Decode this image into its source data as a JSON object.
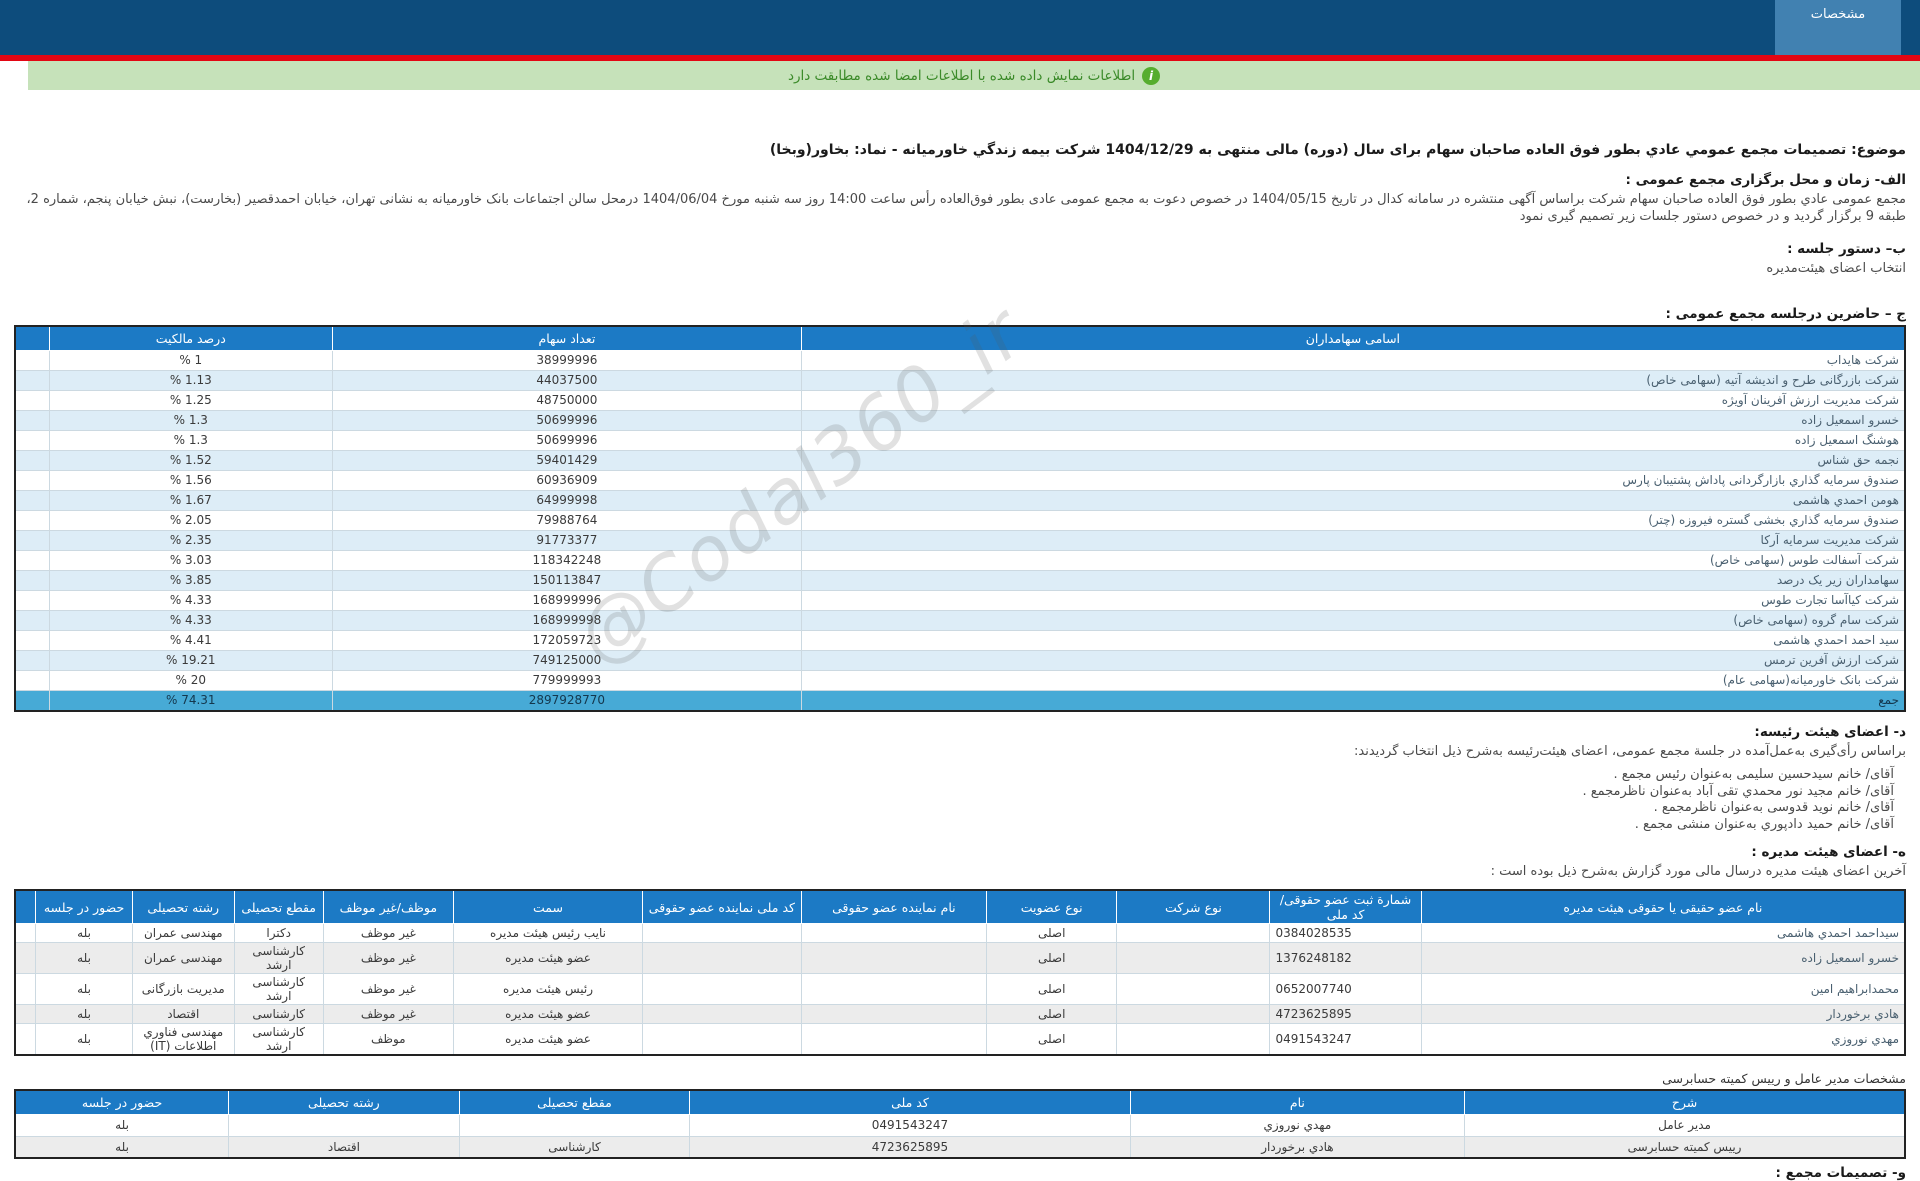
{
  "header": {
    "tab_label": "مشخصات"
  },
  "notice": {
    "text": "اطلاعات نمایش داده شده با اطلاعات امضا شده مطابقت دارد",
    "icon": "info-icon"
  },
  "watermark": "@Codal360_ir",
  "subject": "موضوع: تصمیمات مجمع عمومي عادي بطور فوق العاده صاحبان سهام برای سال (دوره) مالی منتهی به 1404/12/29 شرکت بیمه زندگي خاورمیانه - نماد: بخاور(وبخا)",
  "section_a": {
    "title": "الف- زمان و محل برگزاری مجمع عمومی :",
    "body": "مجمع عمومی عادي بطور فوق العاده صاحبان سهام شرکت براساس آگهی منتشره در سامانه کدال در تاریخ 1404/05/15 در خصوص دعوت به مجمع عمومی عادی بطور فوق‌العاده رأس ساعت 14:00 روز سه شنبه مورخ 1404/06/04 درمحل سالن اجتماعات بانک خاورمیانه به نشانی تهران، خیابان احمدقصیر (بخارست)، نبش خیابان پنجم، شماره 2، طبقه 9 برگزار گردید و در خصوص دستور جلسات زیر تصمیم گیری نمود"
  },
  "section_b": {
    "title": "ب– دستور جلسه :",
    "body": "انتخاب اعضای هیئت‌مدیره"
  },
  "section_c": {
    "title": "ج – حاضرین درجلسه مجمع عمومی :",
    "table": {
      "columns": [
        "اسامی سهامداران",
        "تعداد سهام",
        "درصد مالکیت"
      ],
      "rows": [
        [
          "شرکت هایداب",
          "38999996",
          "% 1"
        ],
        [
          "شرکت بازرگانی طرح و اندیشه آتیه (سهامی خاص)",
          "44037500",
          "% 1.13"
        ],
        [
          "شرکت مدیریت ارزش آفرینان آویژه",
          "48750000",
          "% 1.25"
        ],
        [
          "خسرو اسمعیل زاده",
          "50699996",
          "% 1.3"
        ],
        [
          "هوشنگ اسمعیل زاده",
          "50699996",
          "% 1.3"
        ],
        [
          "نجمه حق شناس",
          "59401429",
          "% 1.52"
        ],
        [
          "صندوق سرمایه گذاري بازارگردانی پاداش پشتیبان پارس",
          "60936909",
          "% 1.56"
        ],
        [
          "هومن احمدي هاشمی",
          "64999998",
          "% 1.67"
        ],
        [
          "صندوق سرمایه گذاري بخشی گستره فیروزه (چتر)",
          "79988764",
          "% 2.05"
        ],
        [
          "شرکت مدیریت سرمایه آرکا",
          "91773377",
          "% 2.35"
        ],
        [
          "شرکت آسفالت طوس (سهامی خاص)",
          "118342248",
          "% 3.03"
        ],
        [
          "سهامداران زیر یک درصد",
          "150113847",
          "% 3.85"
        ],
        [
          "شرکت کیاآسا تجارت طوس",
          "168999996",
          "% 4.33"
        ],
        [
          "شرکت سام گروه (سهامی خاص)",
          "168999998",
          "% 4.33"
        ],
        [
          "سید احمد احمدي هاشمی",
          "172059723",
          "% 4.41"
        ],
        [
          "شرکت ارزش آفرین ترمس",
          "749125000",
          "% 19.21"
        ],
        [
          "شرکت بانک خاورمیانه(سهامی عام)",
          "779999993",
          "% 20"
        ]
      ],
      "total": [
        "جمع",
        "2897928770",
        "% 74.31"
      ]
    }
  },
  "section_d": {
    "title": "د- اعضای هیئت رئیسه:",
    "body": "براساس رأی‌گیری به‌عمل‌آمده در جلسة مجمع عمومی، اعضای هیئت‌رئیسه به‌شرح ذیل انتخاب گردیدند:",
    "members": [
      "آقای/ خانم  سیدحسین سلیمی  به‌عنوان رئیس مجمع .",
      "آقای/ خانم  مجید نور محمدي تقی آباد  به‌عنوان ناظرمجمع .",
      "آقای/ خانم  نوید قدوسی  به‌عنوان ناظرمجمع .",
      "آقای/ خانم  حمید دادپوري  به‌عنوان منشی مجمع ."
    ]
  },
  "section_e": {
    "title": "ه- اعضای هیئت مدیره :",
    "body": "آخرین اعضای هیئت مدیره درسال مالی مورد گزارش به‌شرح ذیل بوده است :",
    "table": {
      "columns": [
        "نام عضو حقیقی یا حقوقی هیئت مدیره",
        "شمارة ثبت عضو حقوقی/کد ملی",
        "نوع شرکت",
        "نوع عضویت",
        "نام نماینده عضو حقوقی",
        "کد ملی نماینده عضو حقوقی",
        "سمت",
        "موظف/غیر موظف",
        "مقطع تحصیلی",
        "رشته تحصیلی",
        "حضور در جلسه"
      ],
      "rows": [
        [
          "سیداحمد احمدي هاشمی",
          "0384028535",
          "",
          "اصلی",
          "",
          "",
          "نایب رئیس هیئت مدیره",
          "غیر موظف",
          "دکترا",
          "مهندسی عمران",
          "بله"
        ],
        [
          "خسرو اسمعیل زاده",
          "1376248182",
          "",
          "اصلی",
          "",
          "",
          "عضو هیئت مدیره",
          "غیر موظف",
          "کارشناسی ارشد",
          "مهندسی عمران",
          "بله"
        ],
        [
          "محمدابراهیم امین",
          "0652007740",
          "",
          "اصلی",
          "",
          "",
          "رئیس هیئت مدیره",
          "غیر موظف",
          "کارشناسی ارشد",
          "مدیریت بازرگانی",
          "بله"
        ],
        [
          "هادي برخوردار",
          "4723625895",
          "",
          "اصلی",
          "",
          "",
          "عضو هیئت مدیره",
          "غیر موظف",
          "کارشناسی",
          "اقتصاد",
          "بله"
        ],
        [
          "مهدي نوروزي",
          "0491543247",
          "",
          "اصلی",
          "",
          "",
          "عضو هیئت مدیره",
          "موظف",
          "کارشناسی ارشد",
          "مهندسی فناوري اطلاعات (IT)",
          "بله"
        ]
      ]
    }
  },
  "ceo_section": {
    "title": "مشخصات مدیر عامل و رییس کمیته حسابرسی",
    "table": {
      "columns": [
        "شرح",
        "نام",
        "کد ملی",
        "مقطع تحصیلی",
        "رشته تحصیلی",
        "حضور در جلسه"
      ],
      "rows": [
        [
          "مدیر عامل",
          "مهدي نوروزي",
          "0491543247",
          "",
          "",
          "بله"
        ],
        [
          "رییس کمیته حسابرسی",
          "هادي برخوردار",
          "4723625895",
          "کارشناسی",
          "اقتصاد",
          "بله"
        ]
      ]
    }
  },
  "section_f": {
    "title": "و- تصمیمات مجمع :"
  }
}
